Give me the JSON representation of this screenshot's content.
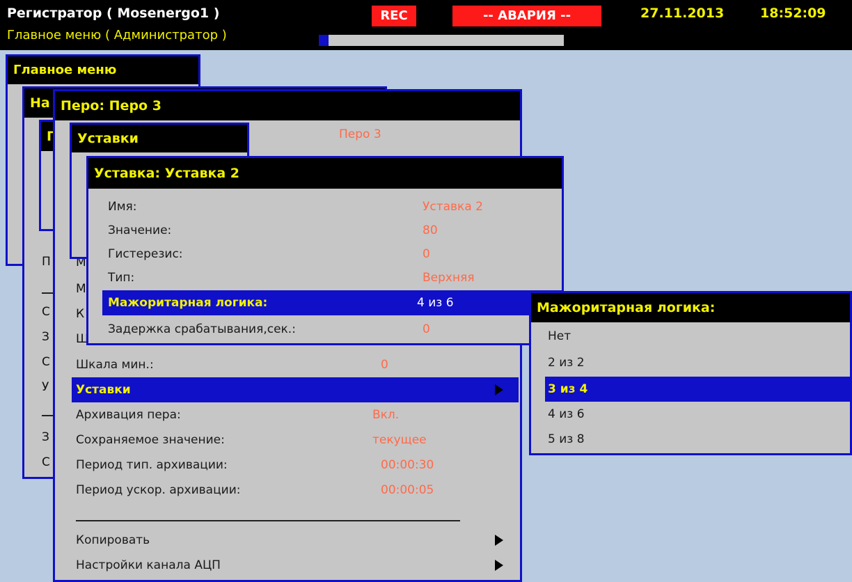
{
  "header": {
    "title": "Регистратор ( Mosenergo1 )",
    "subtitle": "Главное меню ( Администратор )",
    "rec": "REC",
    "alarm": "-- АВАРИЯ --",
    "date": "27.11.2013",
    "time": "18:52:09",
    "progress_pct": 4
  },
  "main_menu": {
    "title": "Главное меню"
  },
  "window2": {
    "title_fragment": "На"
  },
  "window3": {
    "title_fragment": "Г"
  },
  "bg_fragments": [
    "П",
    "М",
    "М",
    "К",
    "Ш",
    "С",
    "З",
    "С",
    "У",
    "З",
    "С"
  ],
  "pen_window": {
    "title": "Перо: Перо 3",
    "name_value": "Перо 3",
    "items": [
      {
        "label": "Шкала мин.:",
        "value": "0"
      },
      {
        "label": "Уставки",
        "value": "",
        "selected": true,
        "submenu": true
      },
      {
        "label": "Архивация пера:",
        "value": "Вкл."
      },
      {
        "label": "Сохраняемое значение:",
        "value": "текущее"
      },
      {
        "label": "Период тип. архивации:",
        "value": "00:00:30"
      },
      {
        "label": "Период ускор. архивации:",
        "value": "00:00:05"
      }
    ],
    "footer_items": [
      {
        "label": "Копировать",
        "submenu": true
      },
      {
        "label": "Настройки канала АЦП",
        "submenu": true
      }
    ]
  },
  "setpoints_window": {
    "title": "Уставки"
  },
  "setpoint_window": {
    "title": "Уставка: Уставка 2",
    "rows": [
      {
        "label": "Имя:",
        "value": "Уставка 2"
      },
      {
        "label": "Значение:",
        "value": "80"
      },
      {
        "label": "Гистерезис:",
        "value": "0"
      },
      {
        "label": "Тип:",
        "value": "Верхняя"
      },
      {
        "label": "Мажоритарная логика:",
        "value": "4 из 6",
        "selected": true
      },
      {
        "label": "Задержка срабатывания,сек.:",
        "value": "0"
      }
    ]
  },
  "dropdown": {
    "title": "Мажоритарная логика:",
    "options": [
      {
        "label": "Нет"
      },
      {
        "label": "2 из 2"
      },
      {
        "label": "3 из 4",
        "selected": true
      },
      {
        "label": "4 из 6"
      },
      {
        "label": "5 из 8"
      }
    ]
  },
  "colors": {
    "background": "#b8cbe0",
    "window": "#c6c6c6",
    "border": "#1010c8",
    "header_bg": "#000000",
    "header_text": "#f2f200",
    "value_text": "#ff6a4a",
    "alarm": "#ff1a1a"
  }
}
